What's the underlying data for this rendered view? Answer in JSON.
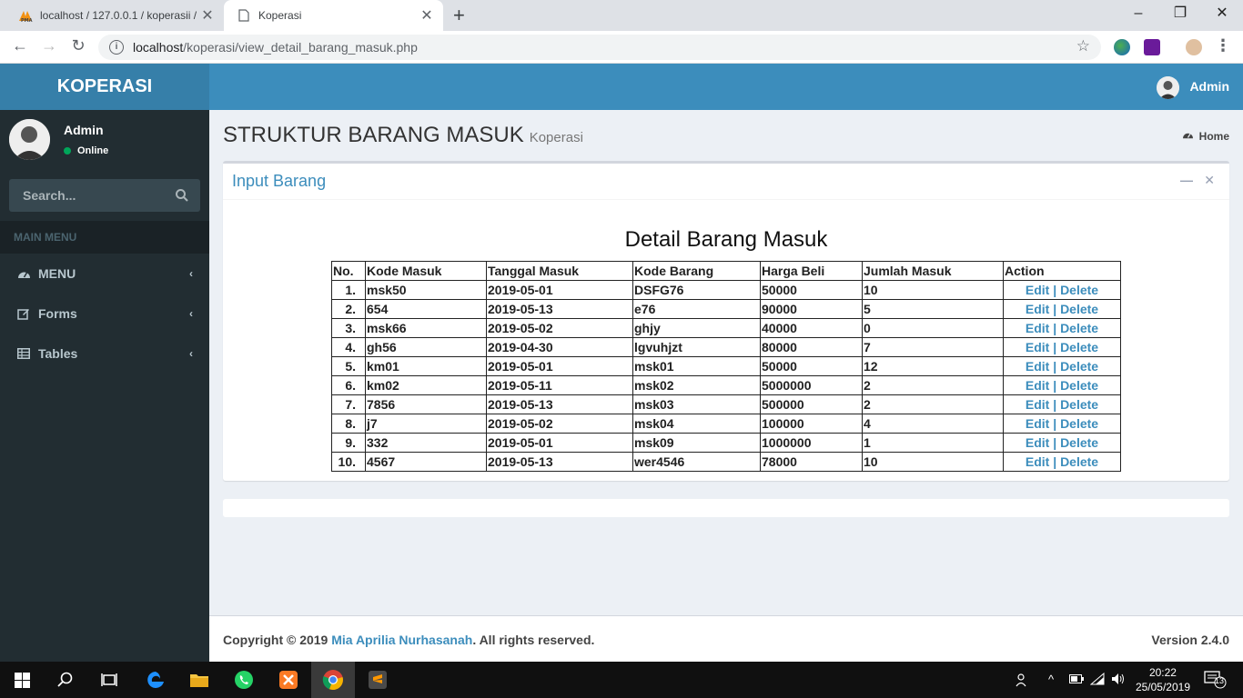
{
  "browser": {
    "tabs": [
      {
        "title": "localhost / 127.0.0.1 / koperasii / ",
        "active": false
      },
      {
        "title": "Koperasi",
        "active": true
      }
    ],
    "url_host": "localhost",
    "url_path": "/koperasi/view_detail_barang_masuk.php"
  },
  "header": {
    "brand": "KOPERASI",
    "user": "Admin"
  },
  "sidebar": {
    "user_name": "Admin",
    "user_status": "Online",
    "search_placeholder": "Search...",
    "menu_header": "MAIN MENU",
    "items": [
      {
        "label": "MENU",
        "icon": "dashboard-icon"
      },
      {
        "label": "Forms",
        "icon": "edit-icon"
      },
      {
        "label": "Tables",
        "icon": "table-icon"
      }
    ]
  },
  "page": {
    "title": "STRUKTUR BARANG MASUK",
    "subtitle": "Koperasi",
    "breadcrumb": "Home",
    "box_title": "Input Barang",
    "table_heading": "Detail Barang Masuk",
    "columns": [
      "No.",
      "Kode Masuk",
      "Tanggal Masuk",
      "Kode Barang",
      "Harga Beli",
      "Jumlah Masuk",
      "Action"
    ],
    "rows": [
      {
        "no": "1.",
        "kode_masuk": "msk50",
        "tanggal": "2019-05-01",
        "kode_barang": "DSFG76",
        "harga": "50000",
        "jumlah": "10"
      },
      {
        "no": "2.",
        "kode_masuk": "654",
        "tanggal": "2019-05-13",
        "kode_barang": "e76",
        "harga": "90000",
        "jumlah": "5"
      },
      {
        "no": "3.",
        "kode_masuk": "msk66",
        "tanggal": "2019-05-02",
        "kode_barang": "ghjy",
        "harga": "40000",
        "jumlah": "0"
      },
      {
        "no": "4.",
        "kode_masuk": "gh56",
        "tanggal": "2019-04-30",
        "kode_barang": "lgvuhjzt",
        "harga": "80000",
        "jumlah": "7"
      },
      {
        "no": "5.",
        "kode_masuk": "km01",
        "tanggal": "2019-05-01",
        "kode_barang": "msk01",
        "harga": "50000",
        "jumlah": "12"
      },
      {
        "no": "6.",
        "kode_masuk": "km02",
        "tanggal": "2019-05-11",
        "kode_barang": "msk02",
        "harga": "5000000",
        "jumlah": "2"
      },
      {
        "no": "7.",
        "kode_masuk": "7856",
        "tanggal": "2019-05-13",
        "kode_barang": "msk03",
        "harga": "500000",
        "jumlah": "2"
      },
      {
        "no": "8.",
        "kode_masuk": "j7",
        "tanggal": "2019-05-02",
        "kode_barang": "msk04",
        "harga": "100000",
        "jumlah": "4"
      },
      {
        "no": "9.",
        "kode_masuk": "332",
        "tanggal": "2019-05-01",
        "kode_barang": "msk09",
        "harga": "1000000",
        "jumlah": "1"
      },
      {
        "no": "10.",
        "kode_masuk": "4567",
        "tanggal": "2019-05-13",
        "kode_barang": "wer4546",
        "harga": "78000",
        "jumlah": "10"
      }
    ],
    "edit_label": "Edit",
    "sep": " | ",
    "delete_label": "Delete"
  },
  "footer": {
    "copyright_prefix": "Copyright © 2019 ",
    "author": "Mia Aprilia Nurhasanah",
    "copyright_suffix": ". All rights reserved.",
    "version": "Version 2.4.0"
  },
  "taskbar": {
    "time": "20:22",
    "date": "25/05/2019",
    "notifications": "13"
  },
  "colors": {
    "primary": "#3c8dbc",
    "logo": "#367fa9",
    "sidebar": "#222d32"
  }
}
